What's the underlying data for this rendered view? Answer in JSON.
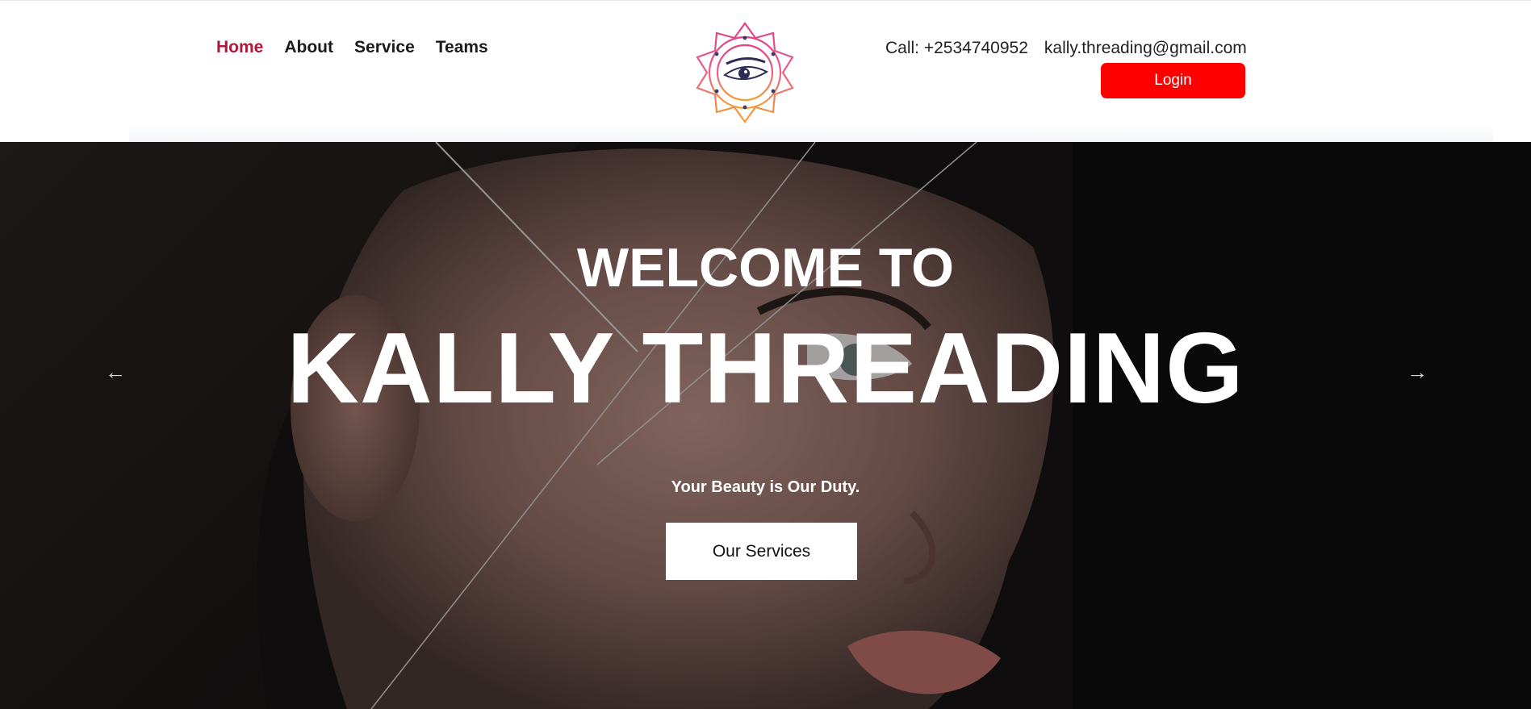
{
  "nav": {
    "items": [
      {
        "label": "Home",
        "active": true
      },
      {
        "label": "About",
        "active": false
      },
      {
        "label": "Service",
        "active": false
      },
      {
        "label": "Teams",
        "active": false
      }
    ]
  },
  "logo": {
    "text": "Kally Threading",
    "icon": "eye-mandala-logo"
  },
  "contact": {
    "phone": "Call: +2534740952",
    "email": "kally.threading@gmail.com",
    "login_label": "Login"
  },
  "hero": {
    "welcome": "WELCOME TO",
    "brand": "KALLY THREADING",
    "tagline": "Your Beauty is Our Duty.",
    "cta_label": "Our Services",
    "prev_icon": "arrow-left-icon",
    "next_icon": "arrow-right-icon"
  },
  "colors": {
    "accent_red": "#ff0000",
    "nav_active": "#b0183a",
    "hero_text": "#ffffff"
  }
}
